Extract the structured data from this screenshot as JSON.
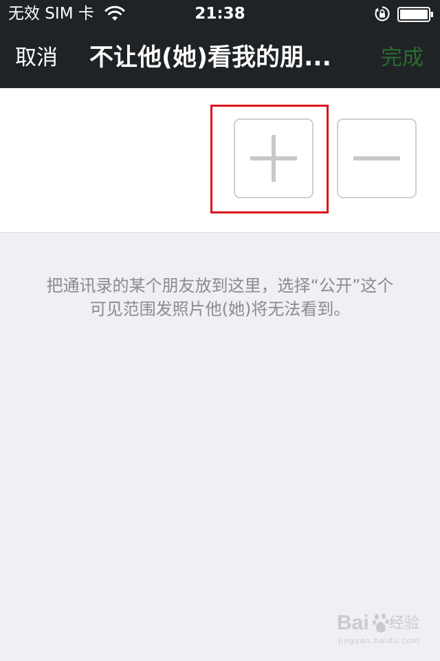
{
  "status_bar": {
    "carrier": "无效 SIM 卡",
    "time": "21:38",
    "icons": [
      "wifi-icon",
      "rotation-lock-icon",
      "battery-icon"
    ]
  },
  "nav_bar": {
    "cancel_label": "取消",
    "title": "不让他(她)看我的朋...",
    "done_label": "完成"
  },
  "member_panel": {
    "add_button_icon": "plus-icon",
    "remove_button_icon": "minus-icon",
    "highlight_color": "#d9141b"
  },
  "hint_text_line1": "把通讯录的某个朋友放到这里，选择“公开”这个",
  "hint_text_line2": "可见范围发照片他(她)将无法看到。",
  "watermark": {
    "brand": "Bai",
    "brand_cn": "经验",
    "url": "jingyan.baidu.com"
  },
  "colors": {
    "bar_background": "#1f2326",
    "done_text": "#2c6b2f",
    "page_background": "#efeff4",
    "hint_text": "#8a8a8f"
  }
}
